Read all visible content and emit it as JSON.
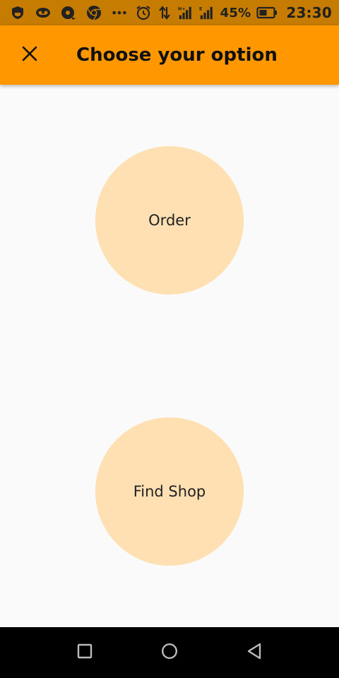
{
  "status_bar": {
    "icons": [
      "shield-icon",
      "voicemail-icon",
      "disc-icon",
      "chrome-icon",
      "more-dots-icon",
      "alarm-icon",
      "data-arrows-icon",
      "signal-h-icon",
      "signal-e-icon",
      "battery-icon"
    ],
    "signal_1_label": "H+",
    "signal_2_label": "E",
    "battery_percent": "45%",
    "time": "23:30"
  },
  "app_bar": {
    "close_icon": "close-icon",
    "title": "Choose your option",
    "background_color": "#ff9800"
  },
  "options": {
    "order_label": "Order",
    "find_shop_label": "Find Shop",
    "circle_color": "#ffe0b2"
  },
  "nav_bar": {
    "icons": [
      "recent-apps-icon",
      "home-icon",
      "back-icon"
    ]
  }
}
